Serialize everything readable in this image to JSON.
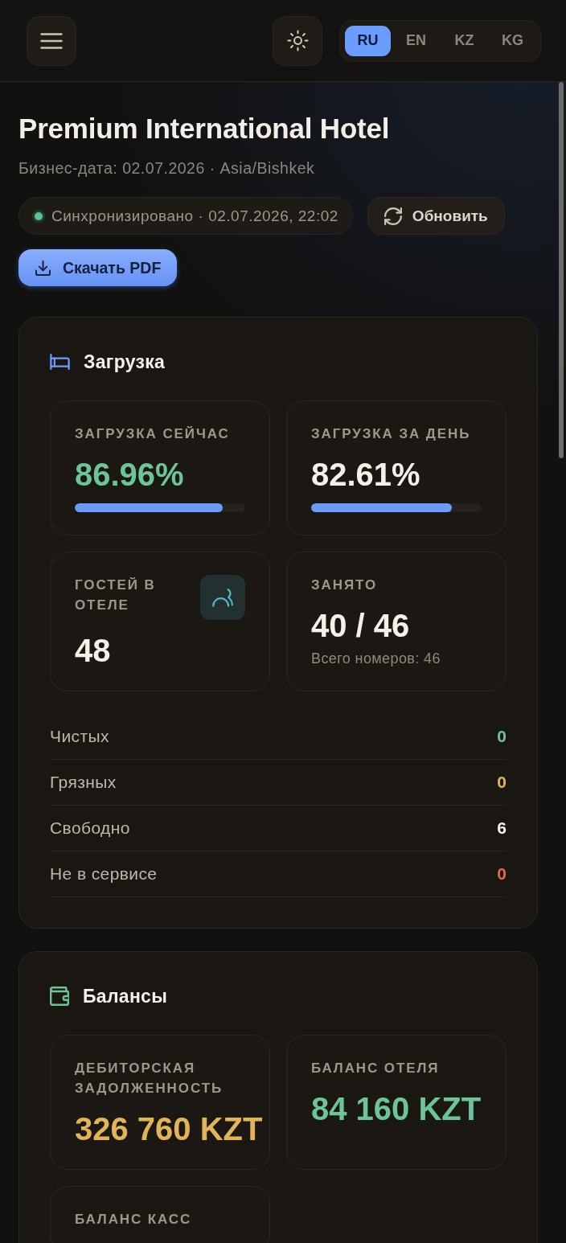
{
  "header": {
    "languages": [
      {
        "label": "RU",
        "selected": true
      },
      {
        "label": "EN",
        "selected": false
      },
      {
        "label": "KZ",
        "selected": false
      },
      {
        "label": "KG",
        "selected": false
      }
    ]
  },
  "hotel": {
    "title": "Premium International Hotel",
    "subtitle": "Бизнес-дата: 02.07.2026 · Asia/Bishkek"
  },
  "sync": {
    "synced": true,
    "label": "Синхронизировано",
    "time": "· 02.07.2026, 22:02"
  },
  "actions": {
    "refresh": "Обновить",
    "download": "Скачать PDF"
  },
  "occupancy": {
    "title": "Загрузка",
    "tiles": [
      {
        "kind": "progress",
        "label": "ЗАГРУЗКА СЕЙЧАС",
        "value": "86.96%",
        "color": "#6cc59a",
        "level": 0.8696
      },
      {
        "kind": "progress",
        "label": "ЗАГРУЗКА ЗА ДЕНЬ",
        "value": "82.61%",
        "color": "#f4f0ea",
        "level": 0.8261
      },
      {
        "kind": "icon",
        "label": "ГОСТЕЙ В ОТЕЛЕ",
        "value": "48",
        "color": "#f4f0ea"
      },
      {
        "kind": "note",
        "label": "ЗАНЯТО",
        "value": "40 / 46",
        "color": "#f4f0ea",
        "note": "Всего номеров: 46"
      }
    ],
    "rows": [
      {
        "label": "Чистых",
        "value": "0",
        "color": "#6cc59a"
      },
      {
        "label": "Грязных",
        "value": "0",
        "color": "#e3b456"
      },
      {
        "label": "Свободно",
        "value": "6",
        "color": "#f4f0ea"
      },
      {
        "label": "Не в сервисе",
        "value": "0",
        "color": "#e0675c"
      }
    ]
  },
  "balances": {
    "title": "Балансы",
    "tiles": [
      {
        "label": "ДЕБИТОРСКАЯ ЗАДОЛЖЕННОСТЬ",
        "value": "326 760 KZT",
        "color": "#e3b456"
      },
      {
        "label": "БАЛАНС ОТЕЛЯ",
        "value": "84 160 KZT",
        "color": "#6cc59a"
      },
      {
        "label": "БАЛАНС КАСС"
      }
    ]
  }
}
